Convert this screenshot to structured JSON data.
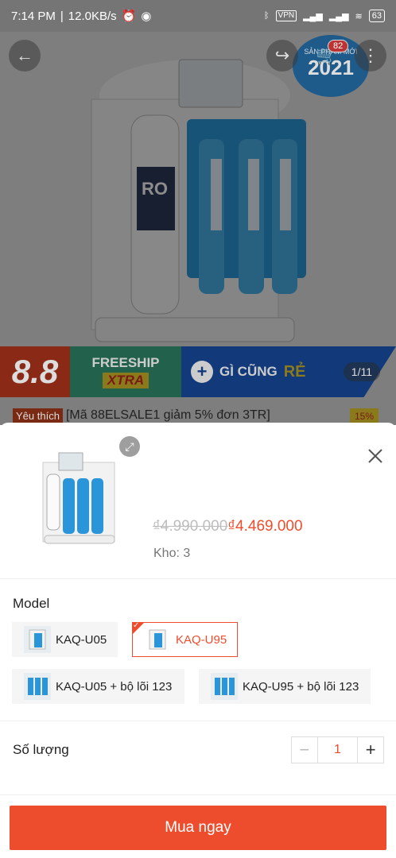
{
  "status_bar": {
    "time": "7:14 PM",
    "speed": "12.0KB/s",
    "vpn": "VPN",
    "battery": "63"
  },
  "hero": {
    "cart_count": "82",
    "badge_text": "SẢN PHẨM MỚI",
    "badge_year": "2021",
    "image_counter": "1/11",
    "banner": {
      "sale": "8.8",
      "freeship": "FREESHIP",
      "xtra": "XTRA",
      "gi_cung": "GÌ CŨNG",
      "re": "RẺ"
    }
  },
  "product": {
    "favorite_tag": "Yêu thích",
    "title_line": "[Mã 88ELSALE1 giảm 5% đơn 3TR]",
    "discount": "15%"
  },
  "sheet": {
    "old_price": "₫4.990.000",
    "new_price": "₫4.469.000",
    "stock": "Kho: 3",
    "model_label": "Model",
    "options": [
      {
        "label": "KAQ-U05",
        "selected": false
      },
      {
        "label": "KAQ-U95",
        "selected": true
      },
      {
        "label": "KAQ-U05 + bộ lõi 123",
        "selected": false
      },
      {
        "label": "KAQ-U95 + bộ lõi 123",
        "selected": false
      }
    ],
    "quantity_label": "Số lượng",
    "quantity": "1",
    "buy_button": "Mua ngay"
  },
  "colors": {
    "accent": "#ee4d2d"
  }
}
